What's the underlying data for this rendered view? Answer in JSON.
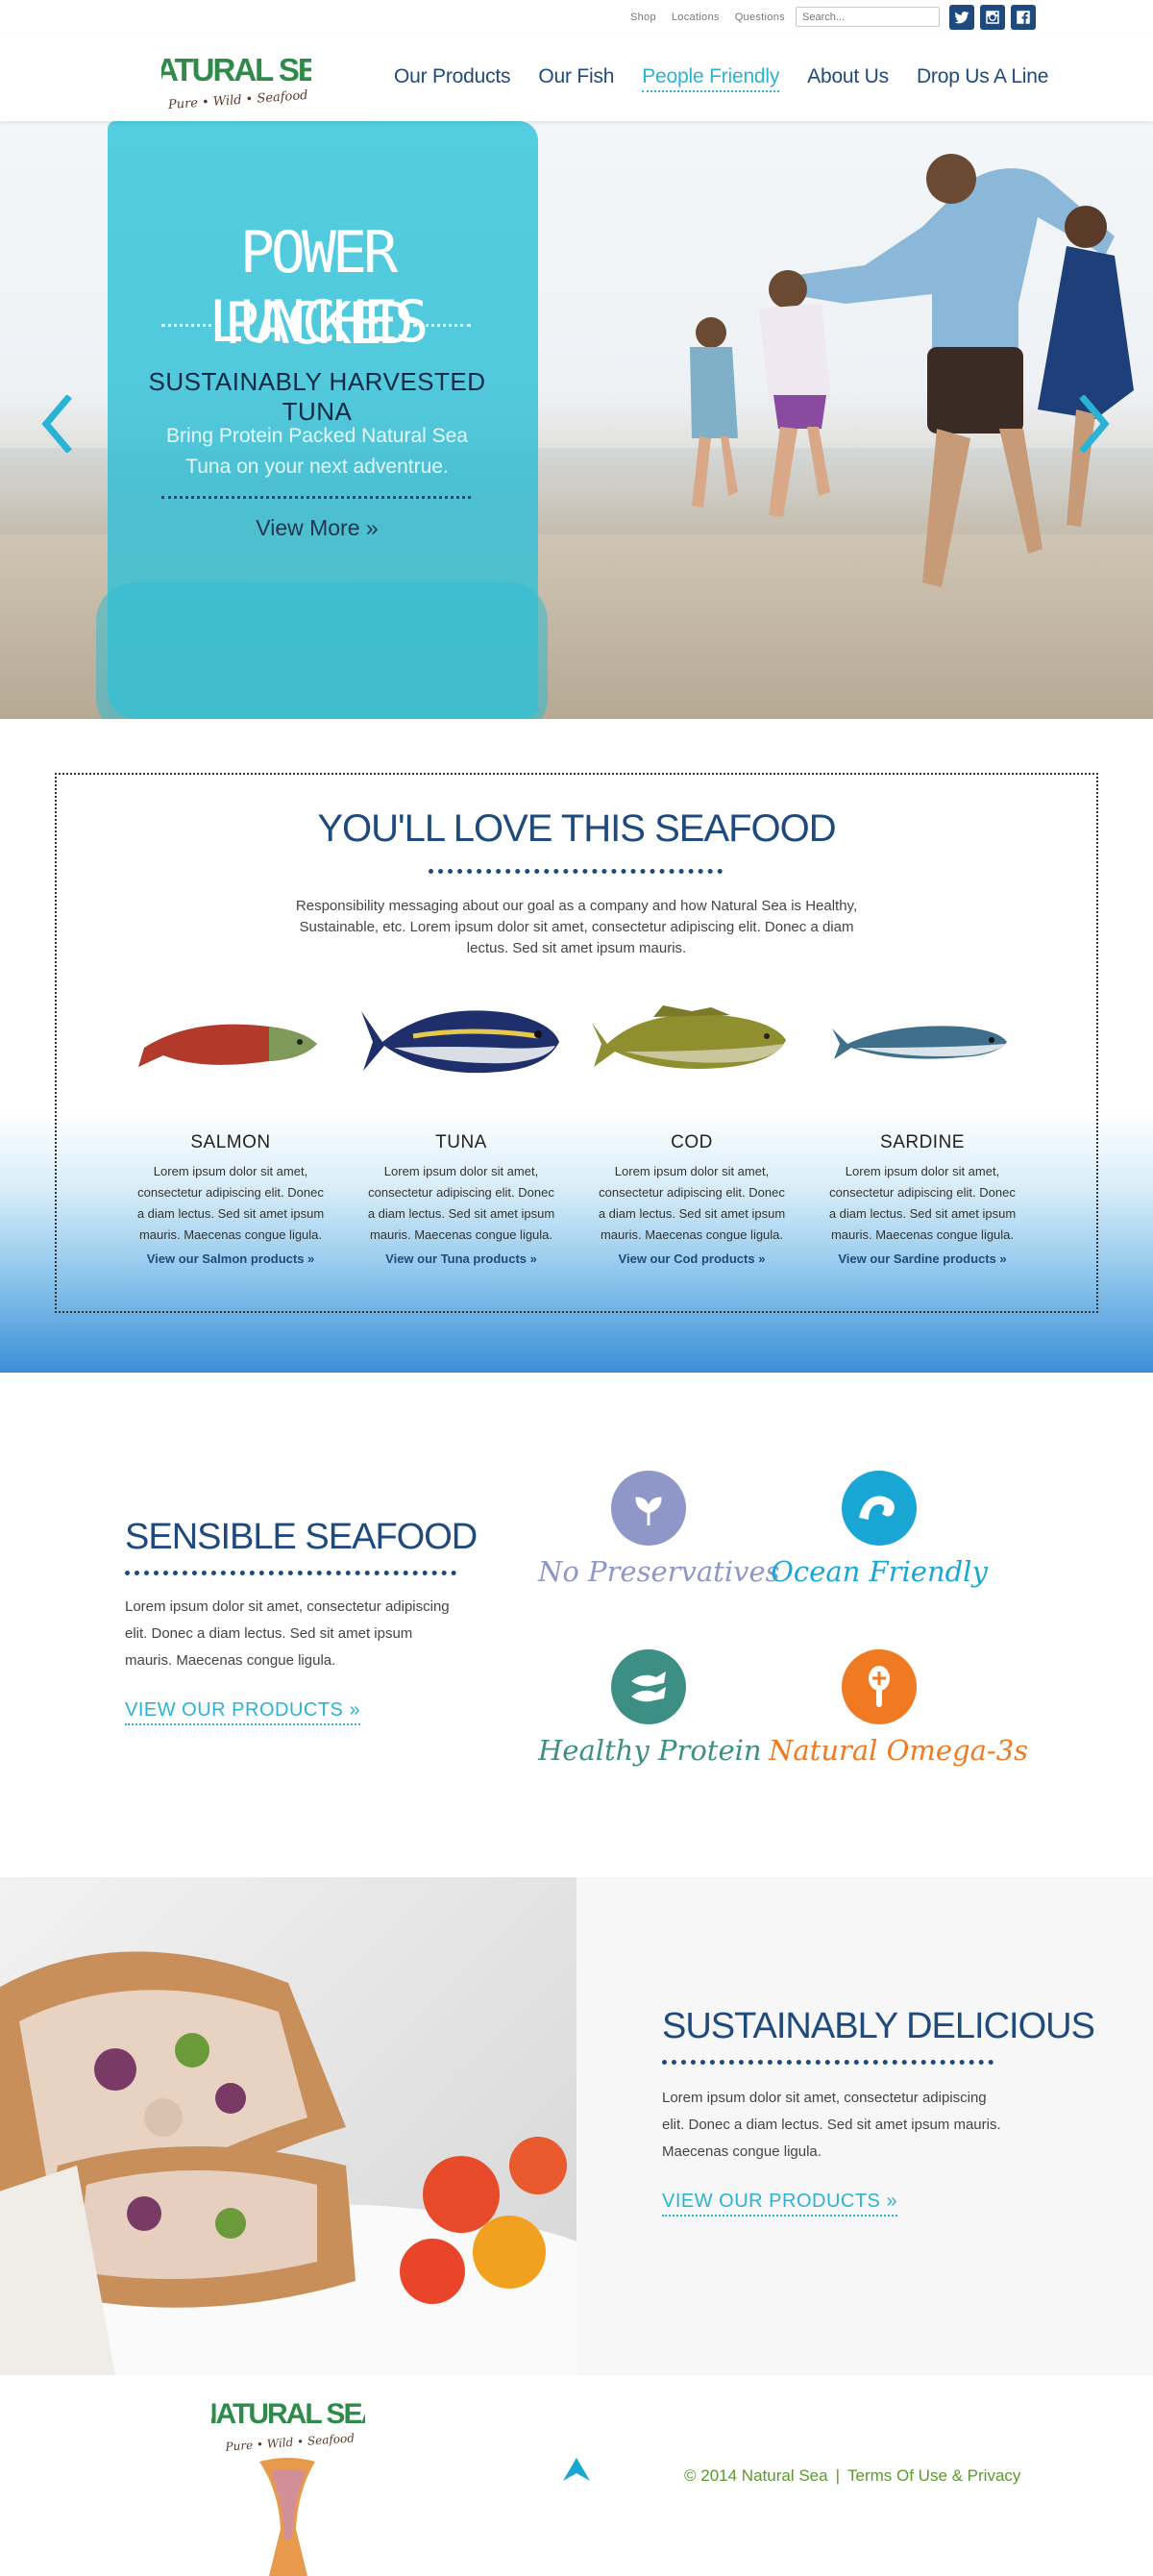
{
  "topbar": {
    "links": [
      "Shop",
      "Locations",
      "Questions"
    ],
    "search_placeholder": "Search...",
    "social": [
      "twitter-icon",
      "instagram-icon",
      "facebook-icon"
    ]
  },
  "brand": {
    "name": "NATURAL SEA",
    "tagline": "Pure • Wild • Seafood"
  },
  "nav": {
    "items": [
      "Our Products",
      "Our Fish",
      "People Friendly",
      "About Us",
      "Drop Us A Line"
    ],
    "active": "People Friendly"
  },
  "hero": {
    "title_line1": "POWER PACKED",
    "title_line2": "LUNCHES",
    "subtitle": "SUSTAINABLY HARVESTED TUNA",
    "description": "Bring Protein Packed Natural Sea Tuna on your next adventrue.",
    "cta": "View More »"
  },
  "seafood": {
    "title": "YOU'LL LOVE THIS SEAFOOD",
    "description": "Responsibility messaging about our goal as a company and how Natural Sea is Healthy, Sustainable, etc. Lorem ipsum dolor sit amet, consectetur adipiscing elit. Donec a diam lectus. Sed sit amet ipsum mauris.",
    "fish": [
      {
        "name": "SALMON",
        "text": "Lorem ipsum dolor sit amet, consectetur adipiscing elit. Donec a diam lectus. Sed sit amet ipsum mauris. Maecenas congue ligula.",
        "link": "View our Salmon products »"
      },
      {
        "name": "TUNA",
        "text": "Lorem ipsum dolor sit amet, consectetur adipiscing elit. Donec a diam lectus. Sed sit amet ipsum mauris. Maecenas congue ligula.",
        "link": "View our Tuna products »"
      },
      {
        "name": "COD",
        "text": "Lorem ipsum dolor sit amet, consectetur adipiscing elit. Donec a diam lectus. Sed sit amet ipsum mauris. Maecenas congue ligula.",
        "link": "View our Cod products »"
      },
      {
        "name": "SARDINE",
        "text": "Lorem ipsum dolor sit amet, consectetur adipiscing elit. Donec a diam lectus. Sed sit amet ipsum mauris. Maecenas congue ligula.",
        "link": "View our Sardine products »"
      }
    ]
  },
  "sensible": {
    "title": "SENSIBLE SEAFOOD",
    "text": "Lorem ipsum dolor sit amet, consectetur adipiscing elit. Donec a diam lectus. Sed sit amet ipsum mauris. Maecenas congue ligula.",
    "link": "VIEW OUR PRODUCTS »",
    "badges": [
      {
        "label": "No Preservatives",
        "icon": "leaf-icon",
        "color": "#8f96c8"
      },
      {
        "label": "Ocean Friendly",
        "icon": "wave-icon",
        "color": "#1aa6d4"
      },
      {
        "label": "Healthy Protein",
        "icon": "fish-icon",
        "color": "#3d8f85"
      },
      {
        "label": "Natural Omega-3s",
        "icon": "spoon-icon",
        "color": "#ef7a22"
      }
    ]
  },
  "delicious": {
    "title": "SUSTAINABLY DELICIOUS",
    "text": "Lorem ipsum dolor sit amet, consectetur adipiscing elit. Donec a diam lectus. Sed sit amet ipsum mauris. Maecenas congue ligula.",
    "link": "VIEW OUR PRODUCTS »"
  },
  "footer": {
    "copyright": "© 2014 Natural Sea",
    "separator": "|",
    "terms": "Terms Of Use & Privacy"
  },
  "colors": {
    "navy": "#1f4a7d",
    "cyan": "#2ab3d7",
    "green": "#2e8b4a",
    "footer_green": "#5b9a2f"
  }
}
